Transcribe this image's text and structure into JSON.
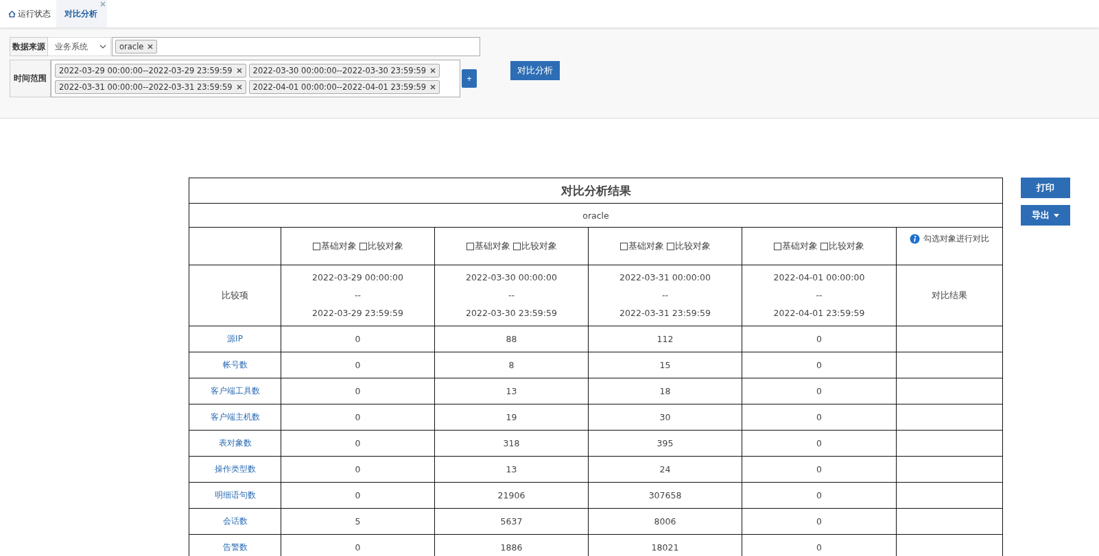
{
  "tabs": [
    {
      "label": "运行状态",
      "selected": false,
      "kind": "home",
      "closable": false
    },
    {
      "label": "对比分析",
      "selected": true,
      "kind": "plain",
      "closable": true
    }
  ],
  "filter": {
    "source_label": "数据来源",
    "source_select": "业务系统",
    "source_tags": [
      "oracle"
    ],
    "time_label": "时间范围",
    "time_tags": [
      "2022-03-29 00:00:00--2022-03-29 23:59:59",
      "2022-03-30 00:00:00--2022-03-30 23:59:59",
      "2022-03-31 00:00:00--2022-03-31 23:59:59",
      "2022-04-01 00:00:00--2022-04-01 23:59:59"
    ],
    "add_button": "+",
    "analyze_button": "对比分析"
  },
  "result": {
    "title": "对比分析结果",
    "subtitle": "oracle",
    "hint": "勾选对象进行对比",
    "item_header": "比较项",
    "result_header": "对比结果",
    "columns": [
      {
        "checkboxes": [
          {
            "label": "基础对象",
            "checked": false
          },
          {
            "label": "比较对象",
            "checked": false
          }
        ],
        "start": "2022-03-29 00:00:00",
        "sep": "--",
        "end": "2022-03-29 23:59:59"
      },
      {
        "checkboxes": [
          {
            "label": "基础对象",
            "checked": false
          },
          {
            "label": "比较对象",
            "checked": false
          }
        ],
        "start": "2022-03-30 00:00:00",
        "sep": "--",
        "end": "2022-03-30 23:59:59"
      },
      {
        "checkboxes": [
          {
            "label": "基础对象",
            "checked": false
          },
          {
            "label": "比较对象",
            "checked": false
          }
        ],
        "start": "2022-03-31 00:00:00",
        "sep": "--",
        "end": "2022-03-31 23:59:59"
      },
      {
        "checkboxes": [
          {
            "label": "基础对象",
            "checked": false
          },
          {
            "label": "比较对象",
            "checked": false
          }
        ],
        "start": "2022-04-01 00:00:00",
        "sep": "--",
        "end": "2022-04-01 23:59:59"
      }
    ],
    "rows": [
      {
        "item": "源IP",
        "values": [
          "0",
          "88",
          "112",
          "0"
        ]
      },
      {
        "item": "帐号数",
        "values": [
          "0",
          "8",
          "15",
          "0"
        ]
      },
      {
        "item": "客户端工具数",
        "values": [
          "0",
          "13",
          "18",
          "0"
        ]
      },
      {
        "item": "客户端主机数",
        "values": [
          "0",
          "19",
          "30",
          "0"
        ]
      },
      {
        "item": "表对象数",
        "values": [
          "0",
          "318",
          "395",
          "0"
        ]
      },
      {
        "item": "操作类型数",
        "values": [
          "0",
          "13",
          "24",
          "0"
        ]
      },
      {
        "item": "明细语句数",
        "values": [
          "0",
          "21906",
          "307658",
          "0"
        ]
      },
      {
        "item": "会话数",
        "values": [
          "5",
          "5637",
          "8006",
          "0"
        ]
      },
      {
        "item": "告警数",
        "values": [
          "0",
          "1886",
          "18021",
          "0"
        ]
      }
    ]
  },
  "actions": {
    "print": "打印",
    "export": "导出"
  }
}
